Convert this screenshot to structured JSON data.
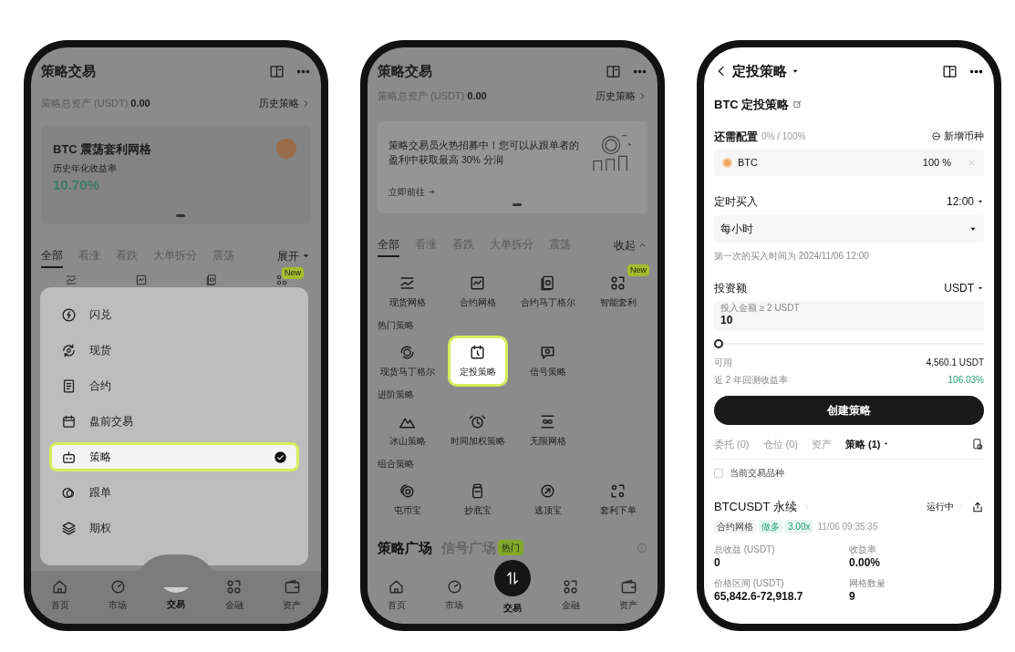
{
  "strategy_menu_screen": {
    "title": "策略交易",
    "assets_label": "策略总资产 (USDT)",
    "assets_value": "0.00",
    "history_link": "历史策略",
    "card": {
      "title": "BTC 震荡套利网格",
      "subtitle": "历史年化收益率",
      "rate": "10.70%"
    },
    "tabs": [
      {
        "label": "全部",
        "selected": true
      },
      {
        "label": "看涨",
        "selected": false
      },
      {
        "label": "看跌",
        "selected": false
      },
      {
        "label": "大单拆分",
        "selected": false
      },
      {
        "label": "震荡",
        "selected": false
      }
    ],
    "expand_link": "展开",
    "new_badge": "New",
    "menu": [
      {
        "label": "闪兑",
        "selected": false
      },
      {
        "label": "现货",
        "selected": false
      },
      {
        "label": "合约",
        "selected": false
      },
      {
        "label": "盘前交易",
        "selected": false
      },
      {
        "label": "策略",
        "selected": true
      },
      {
        "label": "跟单",
        "selected": false
      },
      {
        "label": "期权",
        "selected": false
      }
    ],
    "nav": [
      {
        "label": "首页",
        "selected": false
      },
      {
        "label": "市场",
        "selected": false
      },
      {
        "label": "交易",
        "selected": true
      },
      {
        "label": "金融",
        "selected": false
      },
      {
        "label": "资产",
        "selected": false
      }
    ]
  },
  "strategy_screen": {
    "title": "策略交易",
    "assets_label": "策略总资产 (USDT)",
    "assets_value": "0.00",
    "history_link": "历史策略",
    "banner": {
      "text": "策略交易员火热招募中！您可以从跟单者的盈利中获取最高 30% 分润",
      "link": "立即前往"
    },
    "tabs": [
      {
        "label": "全部",
        "selected": true
      },
      {
        "label": "看涨",
        "selected": false
      },
      {
        "label": "看跌",
        "selected": false
      },
      {
        "label": "大单拆分",
        "selected": false
      },
      {
        "label": "震荡",
        "selected": false
      }
    ],
    "collapse_link": "收起",
    "sections": [
      {
        "items": [
          {
            "label": "现货网格",
            "selected": false
          },
          {
            "label": "合约网格",
            "selected": false
          },
          {
            "label": "合约马丁格尔",
            "selected": false
          },
          {
            "label": "智能套利",
            "selected": false,
            "badge": "New"
          }
        ]
      },
      {
        "title": "热门策略",
        "items": [
          {
            "label": "现货马丁格尔",
            "selected": false
          },
          {
            "label": "定投策略",
            "selected": true
          },
          {
            "label": "信号策略",
            "selected": false
          }
        ]
      },
      {
        "title": "进阶策略",
        "items": [
          {
            "label": "冰山策略",
            "selected": false
          },
          {
            "label": "时间加权策略",
            "selected": false
          },
          {
            "label": "无限网格",
            "selected": false
          }
        ]
      },
      {
        "title": "组合策略",
        "items": [
          {
            "label": "屯币宝",
            "selected": false
          },
          {
            "label": "抄底宝",
            "selected": false
          },
          {
            "label": "逃顶宝",
            "selected": false
          },
          {
            "label": "套利下单",
            "selected": false
          }
        ]
      }
    ],
    "square_tabs": [
      {
        "label": "策略广场",
        "selected": true
      },
      {
        "label": "信号广场",
        "selected": false,
        "badge": "热门"
      }
    ],
    "nav": [
      {
        "label": "首页",
        "selected": false
      },
      {
        "label": "市场",
        "selected": false
      },
      {
        "label": "交易",
        "selected": true
      },
      {
        "label": "金融",
        "selected": false
      },
      {
        "label": "资产",
        "selected": false
      }
    ]
  },
  "dca_screen": {
    "title": "定投策略",
    "strategy_name": "BTC 定投策略",
    "allocation_label": "还需配置",
    "allocation_value": "0% / 100%",
    "add_coin": "新增币种",
    "coins": [
      {
        "symbol": "BTC",
        "percent": "100 %"
      }
    ],
    "schedule_label": "定时买入",
    "schedule_time": "12:00",
    "frequency": "每小时",
    "first_buy_note": "第一次的买入时间为 2024/11/06 12:00",
    "amount_label": "投资额",
    "amount_currency": "USDT",
    "amount_field": {
      "label": "投入金额 ≥ 2 USDT",
      "value": "10"
    },
    "amount_slider": {
      "level": 0
    },
    "available_label": "可用",
    "available_value": "4,560.1 USDT",
    "backtest_label": "近 2 年回测收益率",
    "backtest_value": "106.03%",
    "create_button": "创建策略",
    "order_tabs": [
      {
        "label": "委托 (0)",
        "selected": false
      },
      {
        "label": "仓位 (0)",
        "selected": false
      },
      {
        "label": "资产",
        "selected": false
      },
      {
        "label": "策略 (1)",
        "selected": true
      }
    ],
    "current_pair_filter": {
      "label": "当前交易品种",
      "checked": false
    },
    "position": {
      "pair": "BTCUSDT 永续",
      "status": "运行中",
      "tags": [
        {
          "label": "合约网格",
          "kind": "neutral"
        },
        {
          "label": "做多",
          "kind": "positive"
        },
        {
          "label": "3.00x",
          "kind": "positive"
        }
      ],
      "time": "11/06 09:35:35",
      "stats": [
        {
          "label": "总收益 (USDT)",
          "value": "0"
        },
        {
          "label": "收益率",
          "value": "0.00%"
        },
        {
          "label": "价格区间 (USDT)",
          "value": "65,842.6-72,918.7"
        },
        {
          "label": "网格数量",
          "value": "9"
        }
      ]
    }
  }
}
